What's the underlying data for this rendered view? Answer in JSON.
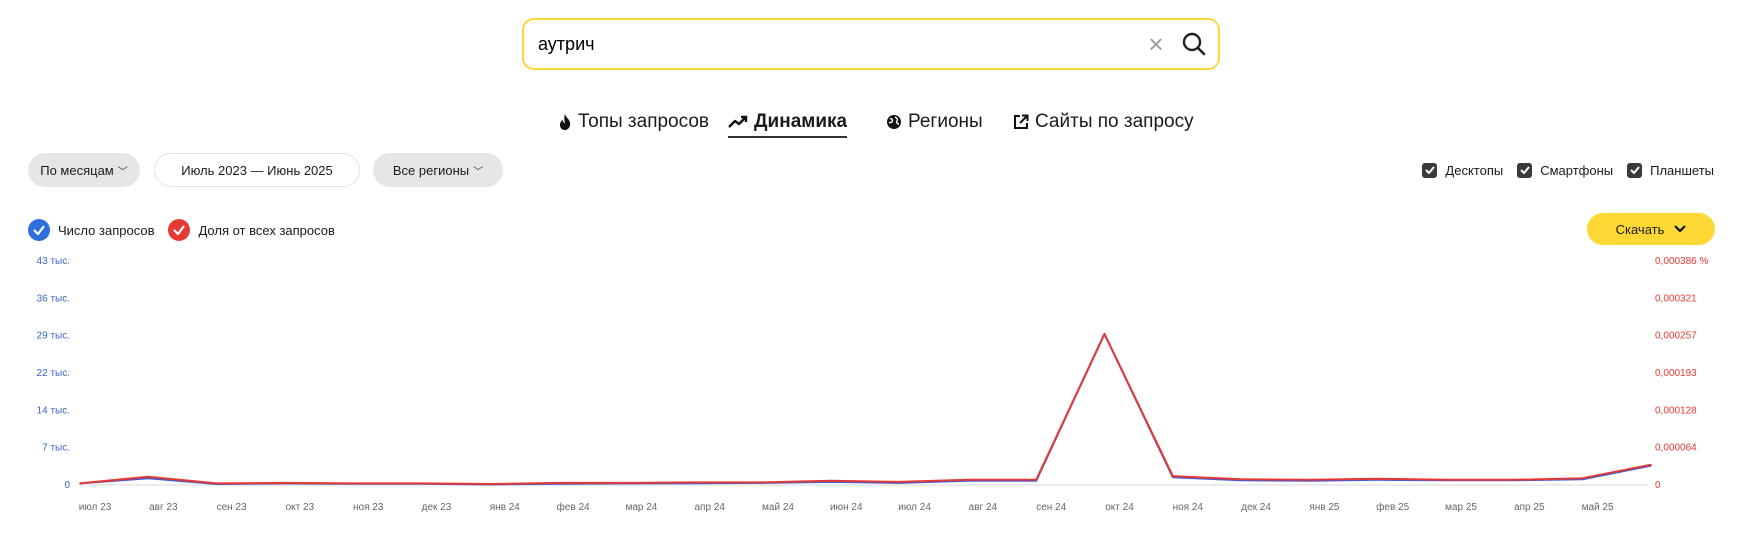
{
  "search": {
    "value": "аутрич",
    "placeholder": ""
  },
  "tabs": [
    {
      "label": "Топы запросов",
      "icon": "fire-icon"
    },
    {
      "label": "Динамика",
      "icon": "trend-icon",
      "active": true
    },
    {
      "label": "Регионы",
      "icon": "globe-icon"
    },
    {
      "label": "Сайты по запросу",
      "icon": "external-link-icon"
    }
  ],
  "filters": {
    "period_group": "По месяцам",
    "date_range": "Июль 2023 — Июнь 2025",
    "regions": "Все регионы"
  },
  "devices": [
    {
      "label": "Десктопы",
      "checked": true
    },
    {
      "label": "Смартфоны",
      "checked": true
    },
    {
      "label": "Планшеты",
      "checked": true
    }
  ],
  "legend": [
    {
      "label": "Число запросов",
      "color": "#2f6fdd"
    },
    {
      "label": "Доля от всех запросов",
      "color": "#e53935"
    }
  ],
  "download_label": "Скачать",
  "chart_data": {
    "type": "line",
    "x": [
      "июл 23",
      "авг 23",
      "сен 23",
      "окт 23",
      "ноя 23",
      "дек 23",
      "янв 24",
      "фев 24",
      "мар 24",
      "апр 24",
      "май 24",
      "июн 24",
      "июл 24",
      "авг 24",
      "сен 24",
      "окт 24",
      "ноя 24",
      "дек 24",
      "янв 25",
      "фев 25",
      "мар 25",
      "апр 25",
      "май 25"
    ],
    "y_left_ticks": [
      "0",
      "7 тыс.",
      "14 тыс.",
      "22 тыс.",
      "29 тыс.",
      "36 тыс.",
      "43 тыс."
    ],
    "y_right_ticks": [
      "0",
      "0,000064",
      "0,000128",
      "0,000193",
      "0,000257",
      "0,000321",
      "0,000386 %"
    ],
    "ylim": [
      0,
      43000
    ],
    "series": [
      {
        "name": "Число запросов",
        "color": "#3b5bdb",
        "values": [
          300,
          1300,
          200,
          300,
          250,
          250,
          100,
          250,
          300,
          350,
          400,
          600,
          400,
          800,
          800,
          29000,
          1500,
          900,
          800,
          1000,
          900,
          900,
          1100,
          3700
        ]
      },
      {
        "name": "Доля от всех запросов",
        "color": "#e53935",
        "values": [
          300,
          1600,
          300,
          400,
          300,
          300,
          200,
          400,
          400,
          500,
          500,
          800,
          600,
          1000,
          1000,
          29000,
          1700,
          1100,
          1000,
          1200,
          1000,
          1000,
          1300,
          3900
        ]
      }
    ]
  }
}
